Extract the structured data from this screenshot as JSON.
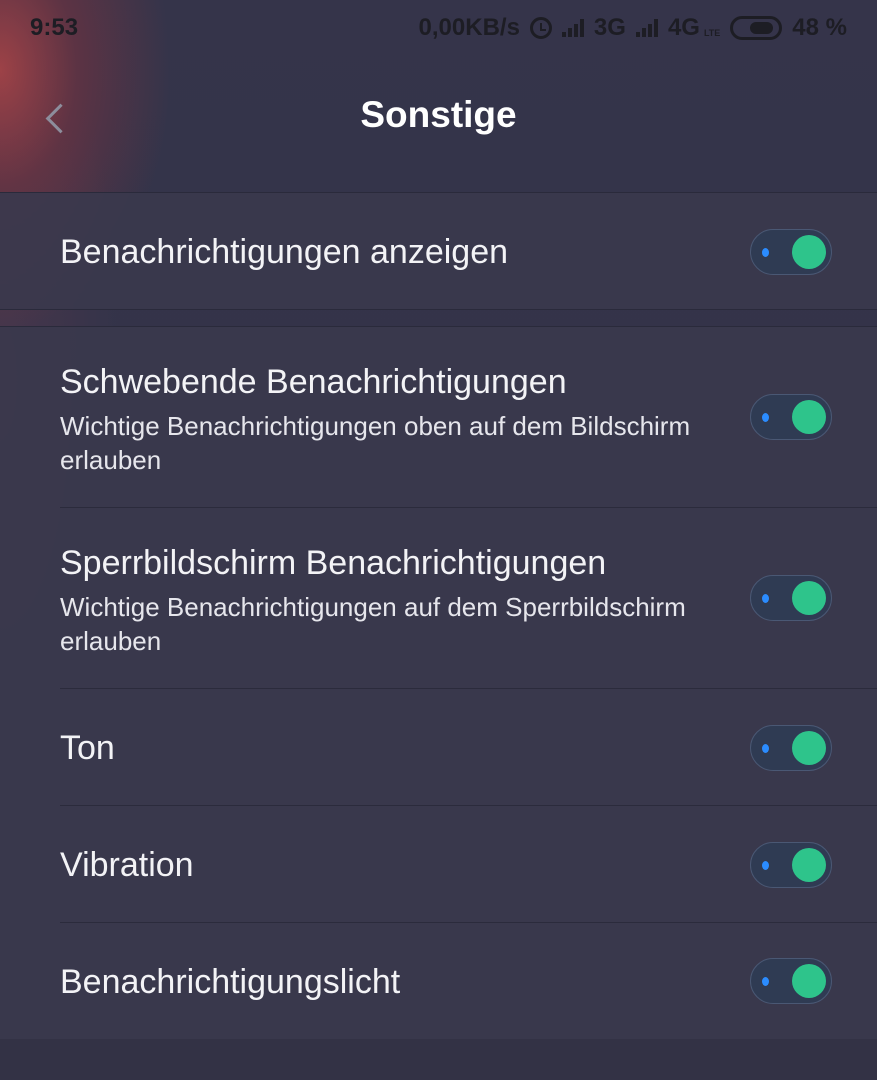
{
  "status_bar": {
    "time": "9:53",
    "network_speed": "0,00KB/s",
    "sim1_network": "3G",
    "sim2_network": "4G",
    "sim2_sub": "LTE",
    "battery_percent": "48 %",
    "icons": [
      "alarm-icon",
      "signal-icon",
      "signal-icon",
      "battery-icon"
    ]
  },
  "header": {
    "title": "Sonstige",
    "back_icon": "chevron-left-icon"
  },
  "settings": [
    {
      "title": "Benachrichtigungen anzeigen",
      "subtitle": "",
      "enabled": true
    },
    {
      "title": "Schwebende Benachrichtigungen",
      "subtitle": "Wichtige Benachrichtigungen oben auf dem Bildschirm erlauben",
      "enabled": true
    },
    {
      "title": "Sperrbildschirm Benachrichtigungen",
      "subtitle": "Wichtige Benachrichtigungen auf dem Sperrbildschirm erlauben",
      "enabled": true
    },
    {
      "title": "Ton",
      "subtitle": "",
      "enabled": true
    },
    {
      "title": "Vibration",
      "subtitle": "",
      "enabled": true
    },
    {
      "title": "Benachrichtigungslicht",
      "subtitle": "",
      "enabled": true
    }
  ],
  "colors": {
    "toggle_on_knob": "#2ec48b",
    "toggle_track": "#2f3b53",
    "toggle_indicator": "#2b8cff",
    "background": "#333349"
  }
}
